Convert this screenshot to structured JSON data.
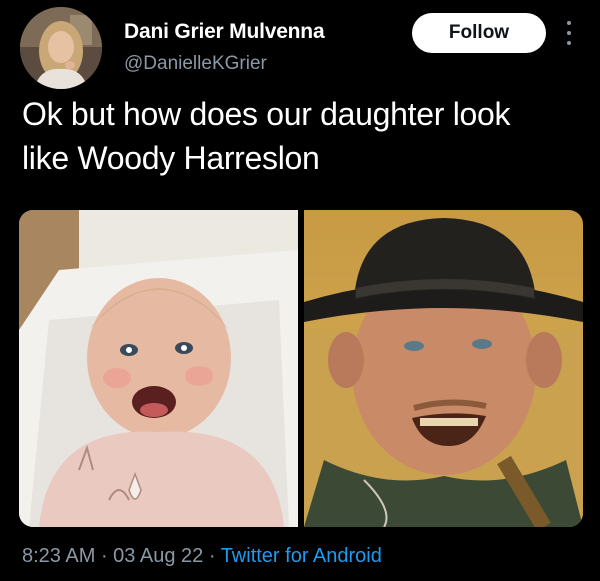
{
  "author": {
    "display_name": "Dani Grier Mulvenna",
    "handle": "@DanielleKGrier"
  },
  "follow_button": {
    "label": "Follow"
  },
  "more_icon": "more-options-icon",
  "tweet": {
    "text_line1": "Ok but how does our daughter look",
    "text_line2": "like Woody Harreslon"
  },
  "media": {
    "left_photo": "baby-photo",
    "right_photo": "actor-in-cowboy-hat-photo"
  },
  "meta": {
    "time": "8:23 AM",
    "separator": " · ",
    "date": "03 Aug 22",
    "source": "Twitter for Android"
  },
  "colors": {
    "background": "#000000",
    "primary_text": "#ffffff",
    "secondary_text": "#8b98a5",
    "link": "#1d9bf0",
    "button_bg": "#ffffff"
  }
}
